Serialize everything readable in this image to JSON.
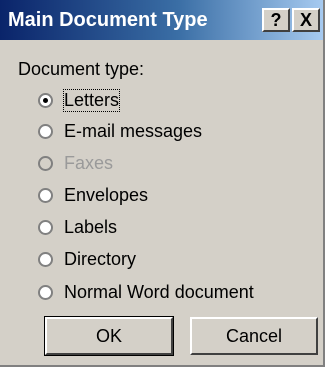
{
  "dialog": {
    "title": "Main Document Type",
    "help_label": "?",
    "close_label": "X"
  },
  "group": {
    "label": "Document type:"
  },
  "options": [
    {
      "label": "Letters",
      "checked": true,
      "disabled": false
    },
    {
      "label": "E-mail messages",
      "checked": false,
      "disabled": false
    },
    {
      "label": "Faxes",
      "checked": false,
      "disabled": true
    },
    {
      "label": "Envelopes",
      "checked": false,
      "disabled": false
    },
    {
      "label": "Labels",
      "checked": false,
      "disabled": false
    },
    {
      "label": "Directory",
      "checked": false,
      "disabled": false
    },
    {
      "label": "Normal Word document",
      "checked": false,
      "disabled": false
    }
  ],
  "buttons": {
    "ok_label": "OK",
    "cancel_label": "Cancel"
  }
}
